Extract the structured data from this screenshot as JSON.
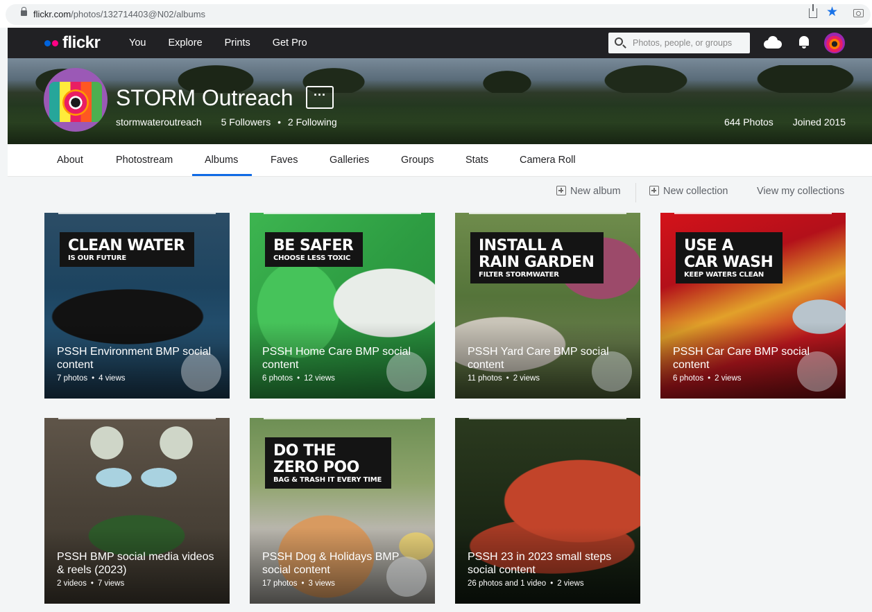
{
  "browser": {
    "url_domain": "flickr.com",
    "url_path": "/photos/132714403@N02/albums"
  },
  "header": {
    "logo_text": "flickr",
    "nav": [
      "You",
      "Explore",
      "Prints",
      "Get Pro"
    ],
    "search_placeholder": "Photos, people, or groups"
  },
  "profile": {
    "name": "STORM Outreach",
    "more_label": "···",
    "username": "stormwateroutreach",
    "followers": "5 Followers",
    "following": "2 Following",
    "photos": "644 Photos",
    "joined": "Joined 2015"
  },
  "subnav": {
    "tabs": [
      "About",
      "Photostream",
      "Albums",
      "Faves",
      "Galleries",
      "Groups",
      "Stats",
      "Camera Roll"
    ],
    "active": "Albums"
  },
  "actions": {
    "new_album": "New album",
    "new_collection": "New collection",
    "view_collections": "View my collections"
  },
  "albums": [
    {
      "title": "PSSH Environment BMP social content",
      "count": "7 photos",
      "views": "4 views",
      "big": [
        "CLEAN WATER"
      ],
      "small": "IS OUR FUTURE"
    },
    {
      "title": "PSSH Home Care BMP social content",
      "count": "6 photos",
      "views": "12 views",
      "big": [
        "BE SAFER"
      ],
      "small": "CHOOSE LESS TOXIC"
    },
    {
      "title": "PSSH Yard Care BMP social content",
      "count": "11 photos",
      "views": "2 views",
      "big": [
        "INSTALL A",
        "RAIN GARDEN"
      ],
      "small": "FILTER STORMWATER"
    },
    {
      "title": "PSSH Car Care BMP social content",
      "count": "6 photos",
      "views": "2 views",
      "big": [
        "USE A",
        "CAR WASH"
      ],
      "small": "KEEP WATERS CLEAN"
    },
    {
      "title": "PSSH BMP social media videos & reels (2023)",
      "count": "2 videos",
      "views": "7 views"
    },
    {
      "title": "PSSH Dog & Holidays BMP social content",
      "count": "17 photos",
      "views": "3 views",
      "big": [
        "DO THE",
        "ZERO POO"
      ],
      "small": "BAG & TRASH IT EVERY TIME"
    },
    {
      "title": "PSSH 23 in 2023 small steps social content",
      "count": "26 photos and 1 video",
      "views": "2 views"
    }
  ]
}
